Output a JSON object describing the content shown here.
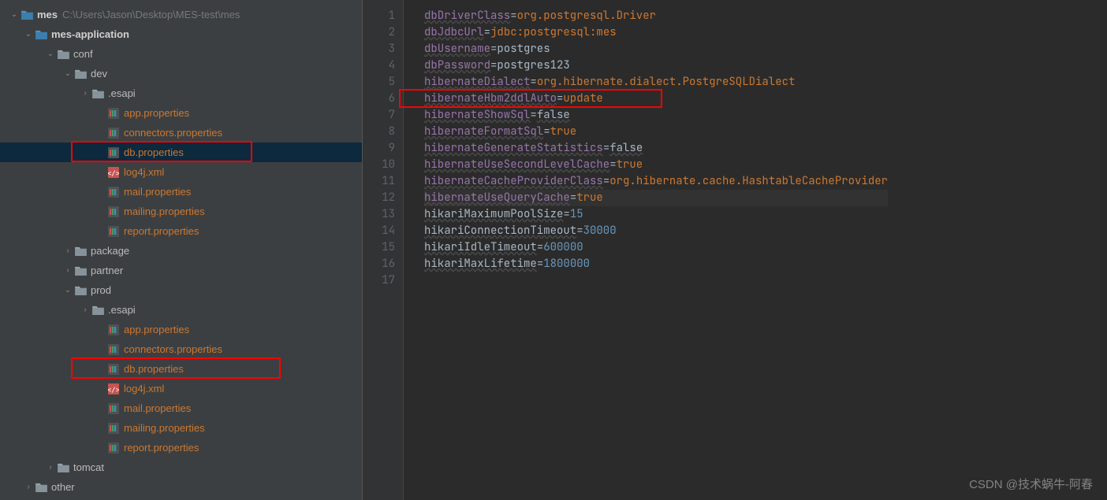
{
  "project": {
    "name": "mes",
    "path": "C:\\Users\\Jason\\Desktop\\MES-test\\mes"
  },
  "tree": [
    {
      "d": 0,
      "a": "down",
      "t": "folder-root",
      "lbl": "mes",
      "path": "C:\\Users\\Jason\\Desktop\\MES-test\\mes"
    },
    {
      "d": 1,
      "a": "down",
      "t": "folder-root",
      "lbl": "mes-application"
    },
    {
      "d": 2,
      "a": "down",
      "t": "folder",
      "lbl": "conf"
    },
    {
      "d": 3,
      "a": "down",
      "t": "folder",
      "lbl": "dev"
    },
    {
      "d": 4,
      "a": "right",
      "t": "folder",
      "lbl": ".esapi"
    },
    {
      "d": 5,
      "a": "",
      "t": "props",
      "lbl": "app.properties",
      "o": true
    },
    {
      "d": 5,
      "a": "",
      "t": "props",
      "lbl": "connectors.properties",
      "o": true
    },
    {
      "d": 5,
      "a": "",
      "t": "props",
      "lbl": "db.properties",
      "o": true,
      "sel": true,
      "rb": "rb1"
    },
    {
      "d": 5,
      "a": "",
      "t": "xml",
      "lbl": "log4j.xml",
      "o": true
    },
    {
      "d": 5,
      "a": "",
      "t": "props",
      "lbl": "mail.properties",
      "o": true
    },
    {
      "d": 5,
      "a": "",
      "t": "props",
      "lbl": "mailing.properties",
      "o": true
    },
    {
      "d": 5,
      "a": "",
      "t": "props",
      "lbl": "report.properties",
      "o": true
    },
    {
      "d": 3,
      "a": "right",
      "t": "folder",
      "lbl": "package"
    },
    {
      "d": 3,
      "a": "right",
      "t": "folder",
      "lbl": "partner"
    },
    {
      "d": 3,
      "a": "down",
      "t": "folder",
      "lbl": "prod"
    },
    {
      "d": 4,
      "a": "right",
      "t": "folder",
      "lbl": ".esapi"
    },
    {
      "d": 5,
      "a": "",
      "t": "props",
      "lbl": "app.properties",
      "o": true
    },
    {
      "d": 5,
      "a": "",
      "t": "props",
      "lbl": "connectors.properties",
      "o": true
    },
    {
      "d": 5,
      "a": "",
      "t": "props",
      "lbl": "db.properties",
      "o": true,
      "rb": "rb2"
    },
    {
      "d": 5,
      "a": "",
      "t": "xml",
      "lbl": "log4j.xml",
      "o": true
    },
    {
      "d": 5,
      "a": "",
      "t": "props",
      "lbl": "mail.properties",
      "o": true
    },
    {
      "d": 5,
      "a": "",
      "t": "props",
      "lbl": "mailing.properties",
      "o": true
    },
    {
      "d": 5,
      "a": "",
      "t": "props",
      "lbl": "report.properties",
      "o": true
    },
    {
      "d": 2,
      "a": "right",
      "t": "folder",
      "lbl": "tomcat"
    },
    {
      "d": 1,
      "a": "right",
      "t": "folder",
      "lbl": "other"
    }
  ],
  "lines": [
    {
      "n": 1,
      "k": "dbDriverClass",
      "v": "org.postgresql.Driver",
      "vc": "v1"
    },
    {
      "n": 2,
      "k": "dbJdbcUrl",
      "v": "jdbc:postgresql:mes",
      "vc": "v1"
    },
    {
      "n": 3,
      "k": "dbUsername",
      "v": "postgres",
      "vc": "v2"
    },
    {
      "n": 4,
      "k": "dbPassword",
      "v": "postgres123",
      "vc": "v2"
    },
    {
      "n": 5,
      "k": "hibernateDialect",
      "v": "org.hibernate.dialect.PostgreSQLDialect",
      "vc": "v1"
    },
    {
      "n": 6,
      "k": "hibernateHbm2ddlAuto",
      "v": "update",
      "vc": "v1",
      "hl": true
    },
    {
      "n": 7,
      "k": "hibernateShowSql",
      "v": "false",
      "vc": "false"
    },
    {
      "n": 8,
      "k": "hibernateFormatSql",
      "v": "true",
      "vc": "v1"
    },
    {
      "n": 9,
      "k": "hibernateGenerateStatistics",
      "v": "false",
      "vc": "false"
    },
    {
      "n": 10,
      "k": "hibernateUseSecondLevelCache",
      "v": "true",
      "vc": "v1"
    },
    {
      "n": 11,
      "k": "hibernateCacheProviderClass",
      "v": "org.hibernate.cache.HashtableCacheProvider",
      "vc": "v1"
    },
    {
      "n": 12,
      "k": "hibernateUseQueryCache",
      "v": "true",
      "vc": "v1",
      "cur": true
    },
    {
      "n": 13,
      "k": "hikariMaximumPoolSize",
      "v": "15",
      "vc": "num",
      "plain": true
    },
    {
      "n": 14,
      "k": "hikariConnectionTimeout",
      "v": "30000",
      "vc": "num",
      "plain": true
    },
    {
      "n": 15,
      "k": "hikariIdleTimeout",
      "v": "600000",
      "vc": "num",
      "plain": true
    },
    {
      "n": 16,
      "k": "hikariMaxLifetime",
      "v": "1800000",
      "vc": "num",
      "plain": true
    },
    {
      "n": 17,
      "k": "",
      "v": "",
      "vc": ""
    }
  ],
  "watermark": "CSDN @技术蜗牛-阿春"
}
